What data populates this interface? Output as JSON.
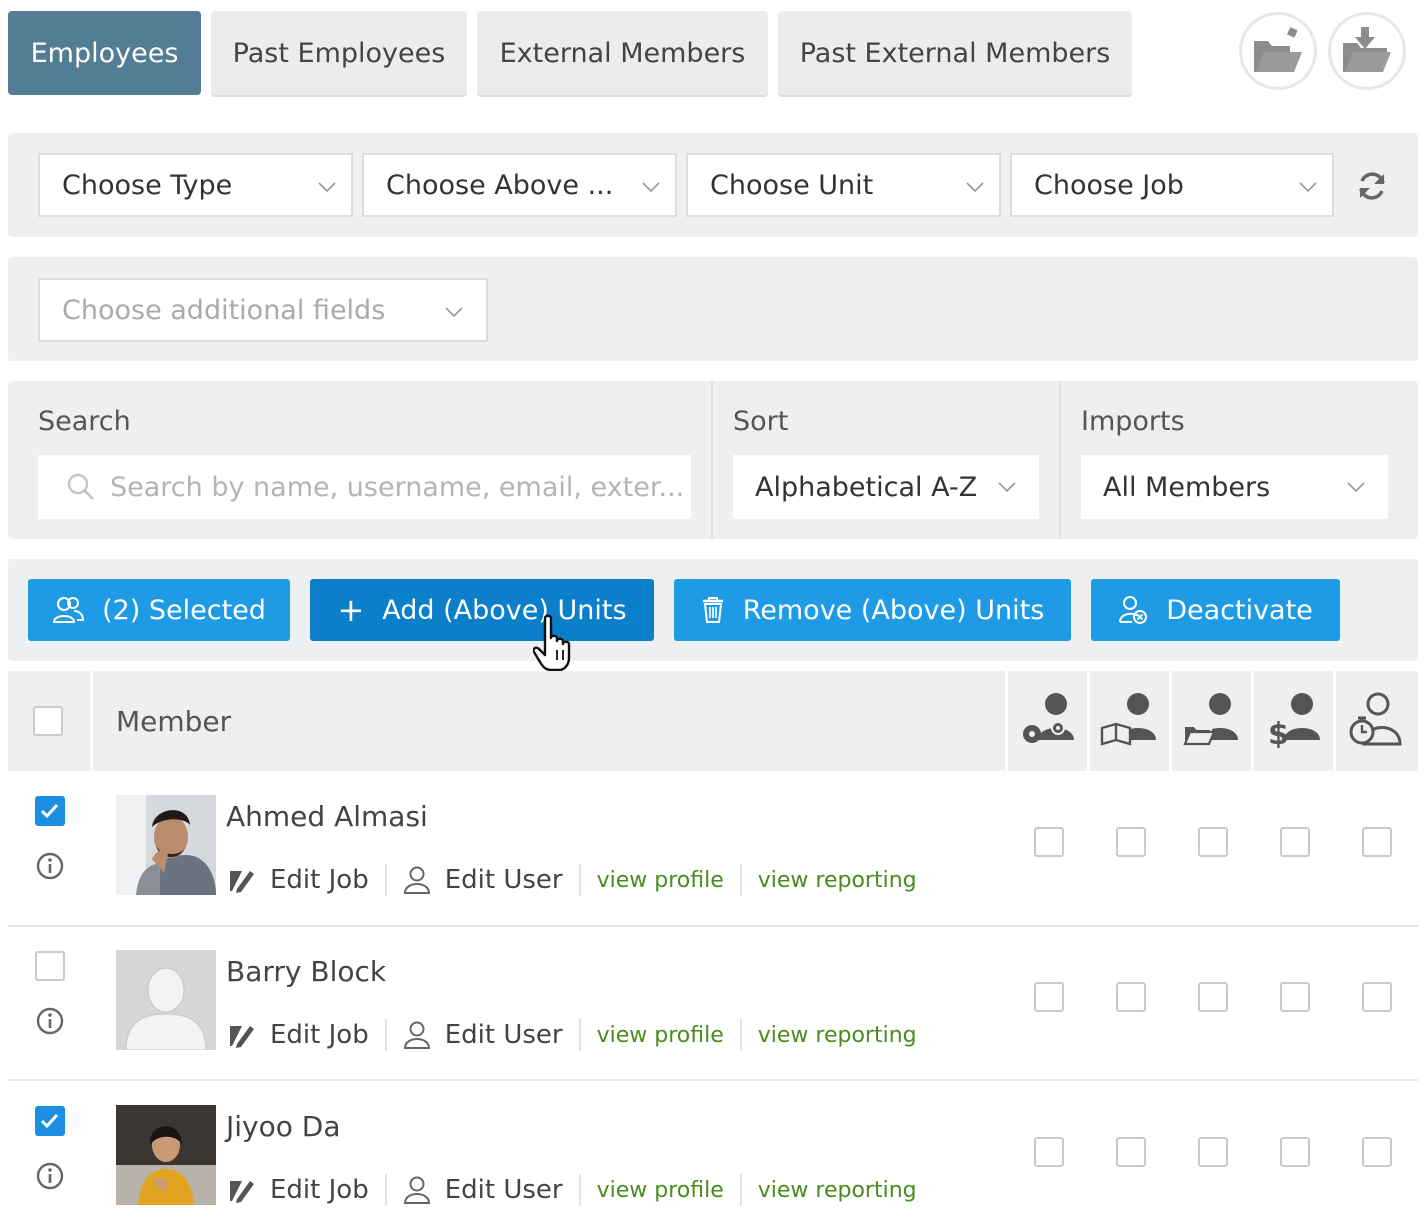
{
  "tabs": [
    {
      "label": "Employees",
      "active": true
    },
    {
      "label": "Past Employees",
      "active": false
    },
    {
      "label": "External Members",
      "active": false
    },
    {
      "label": "Past External Members",
      "active": false
    }
  ],
  "filters": {
    "type": "Choose Type",
    "above": "Choose Above ...",
    "unit": "Choose Unit",
    "job": "Choose Job",
    "additional_fields": "Choose additional fields"
  },
  "search": {
    "label": "Search",
    "placeholder": "Search by name, username, email, exter..."
  },
  "sort": {
    "label": "Sort",
    "value": "Alphabetical A-Z"
  },
  "imports": {
    "label": "Imports",
    "value": "All Members"
  },
  "actions": {
    "selected": "(2) Selected",
    "add_units": "Add (Above) Units",
    "remove_units": "Remove (Above) Units",
    "deactivate": "Deactivate"
  },
  "table": {
    "member_header": "Member",
    "permission_icons": [
      "user-settings-icon",
      "user-training-icon",
      "user-documents-icon",
      "user-payroll-icon",
      "user-timeclock-icon"
    ],
    "rows": [
      {
        "name": "Ahmed Almasi",
        "checked": true,
        "avatar": "photo-man-beard"
      },
      {
        "name": "Barry Block",
        "checked": false,
        "avatar": "placeholder-silhouette"
      },
      {
        "name": "Jiyoo Da",
        "checked": true,
        "avatar": "photo-woman-yellow"
      }
    ],
    "row_links": {
      "edit_job": "Edit Job",
      "edit_user": "Edit User",
      "view_profile": "view profile",
      "view_reporting": "view reporting"
    }
  },
  "colors": {
    "active_tab": "#527d94",
    "action_button": "#1e9be4",
    "action_button_hover": "#0b7fc9",
    "link_green": "#4a8c1d",
    "checkbox_checked": "#1d8fe3"
  }
}
